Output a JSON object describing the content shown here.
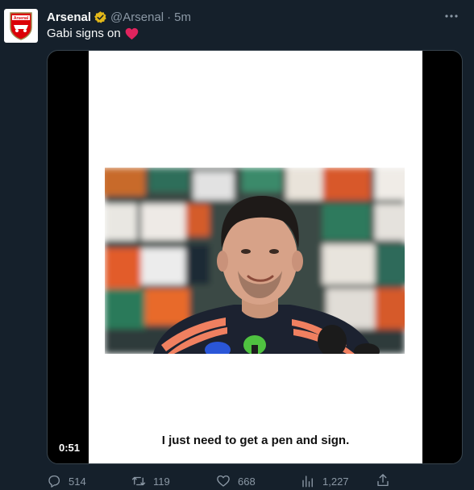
{
  "tweet": {
    "display_name": "Arsenal",
    "handle": "@Arsenal",
    "separator": "·",
    "time": "5m",
    "text": "Gabi signs on",
    "avatar_label": "Arsenal"
  },
  "media": {
    "caption": "I just need to get a pen and sign.",
    "duration": "0:51"
  },
  "actions": {
    "replies": "514",
    "retweets": "119",
    "likes": "668",
    "views": "1,227"
  },
  "icons": {
    "verified": "verified-badge-icon",
    "more": "more-options-icon",
    "heart_emoji": "red-heart-emoji",
    "reply": "reply-icon",
    "retweet": "retweet-icon",
    "like": "like-icon",
    "views": "views-icon",
    "share": "share-icon"
  },
  "colors": {
    "background": "#15202b",
    "secondary_text": "#8b98a5",
    "verified_gold": "#e2b719",
    "heart_red": "#e0245e",
    "arsenal_red": "#db0007"
  }
}
